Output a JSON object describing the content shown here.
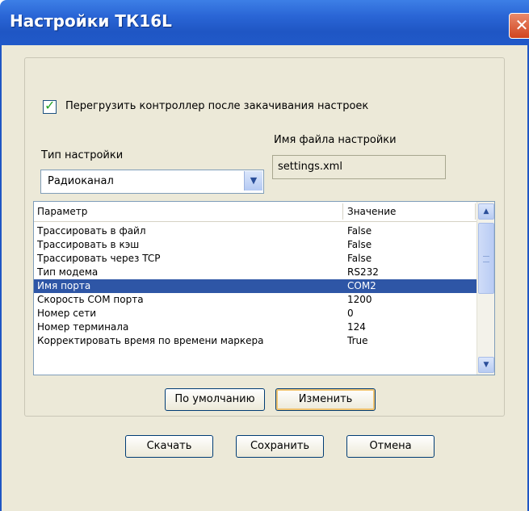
{
  "window": {
    "title": "Настройки ТК16L",
    "close_label": "✕"
  },
  "settings": {
    "reboot_checkbox_label": "Перегрузить контроллер после закачивания настроек",
    "reboot_checked": true,
    "type_label": "Тип настройки",
    "type_value": "Радиоканал",
    "filename_label": "Имя файла настройки",
    "filename_value": "settings.xml"
  },
  "table": {
    "columns": [
      "Параметр",
      "Значение"
    ],
    "rows": [
      {
        "param": "Трассировать в файл",
        "value": "False"
      },
      {
        "param": "Трассировать в кэш",
        "value": "False"
      },
      {
        "param": "Трассировать через TCP",
        "value": "False"
      },
      {
        "param": "Тип модема",
        "value": "RS232"
      },
      {
        "param": "Имя порта",
        "value": "COM2",
        "selected": true
      },
      {
        "param": "Скорость COM порта",
        "value": "1200"
      },
      {
        "param": "Номер сети",
        "value": "0"
      },
      {
        "param": "Номер терминала",
        "value": "124"
      },
      {
        "param": "Корректировать время по времени маркера",
        "value": "True"
      }
    ]
  },
  "buttons": {
    "default": "По умолчанию",
    "change": "Изменить",
    "download": "Скачать",
    "save": "Сохранить",
    "cancel": "Отмена"
  },
  "colors": {
    "titlebar": "#2a66d6",
    "window_bg": "#ece9d8",
    "selection": "#2e56a6"
  },
  "icons": {
    "checkbox": "check-icon",
    "combo_arrow": "chevron-down-icon",
    "scroll_up": "arrow-up-icon",
    "scroll_down": "arrow-down-icon"
  }
}
